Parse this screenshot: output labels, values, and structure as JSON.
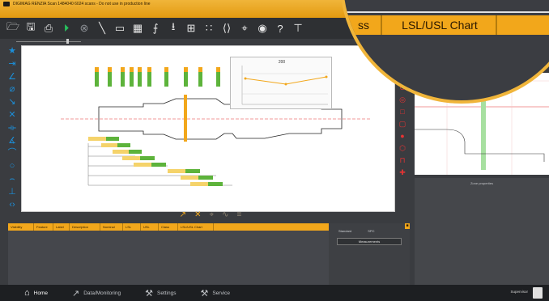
{
  "window": {
    "title": "DIGIMAG RENZIA Scan 1484040 6024 scans - Do not use in production line"
  },
  "toolbar": {
    "icons": [
      "folder-open-icon",
      "save-icon",
      "print-icon",
      "play-icon",
      "stop-icon",
      "measure-line-icon",
      "frame-icon",
      "grid-icon",
      "align-icon",
      "download-icon",
      "bookmark-icon",
      "dimension-icon",
      "code-icon",
      "crosshair-icon",
      "eye-icon",
      "help-icon",
      "tool-icon"
    ],
    "help_label": "?"
  },
  "right_panel": {
    "zone_label": "Zone properties"
  },
  "magnifier": {
    "tab_left": "ss",
    "tab_center": "LSL/USL Chart"
  },
  "mini_chart": {
    "title": "200"
  },
  "table": {
    "columns": [
      "Visibility",
      "Feature",
      "Label",
      "Description",
      "Nominal",
      "LSL",
      "USL",
      "Class",
      "LSL/USL Chart"
    ]
  },
  "measurements": {
    "tabs": [
      "Standard",
      "SPC"
    ],
    "button": "Measurements"
  },
  "status_bar": {
    "items": [
      {
        "label": "Home",
        "icon": "home-icon"
      },
      {
        "label": "Data/Monitoring",
        "icon": "chart-icon"
      },
      {
        "label": "Settings",
        "icon": "settings-icon"
      },
      {
        "label": "Service",
        "icon": "service-icon"
      }
    ],
    "user": "Supervisor"
  },
  "colors": {
    "accent": "#f2a71b",
    "left_icons": "#1c8fd9",
    "right_icons": "#e53333",
    "dimension": "#5db33b"
  }
}
